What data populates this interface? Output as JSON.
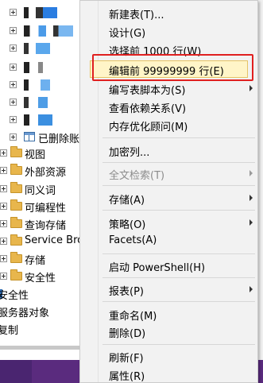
{
  "tree": {
    "deleted_label": "已删除账",
    "folders": [
      {
        "label": "视图"
      },
      {
        "label": "外部资源"
      },
      {
        "label": "同义词"
      },
      {
        "label": "可编程性"
      },
      {
        "label": "查询存储"
      },
      {
        "label": "Service Bro"
      },
      {
        "label": "存储"
      },
      {
        "label": "安全性"
      }
    ],
    "security_label": "安全性",
    "server_objects_label": "服务器对象",
    "replication_label": "复制"
  },
  "menu": {
    "new_table": "新建表(T)...",
    "design": "设计(G)",
    "select_top": "选择前 1000 行(W)",
    "edit_top": "编辑前 99999999 行(E)",
    "script_as": "编写表脚本为(S)",
    "view_deps": "查看依赖关系(V)",
    "memory_advisor": "内存优化顾问(M)",
    "encrypt_columns": "加密列...",
    "fulltext_index": "全文检索(T)",
    "storage": "存储(A)",
    "policies": "策略(O)",
    "facets": "Facets(A)",
    "powershell": "启动 PowerShell(H)",
    "reports": "报表(P)",
    "rename": "重命名(M)",
    "delete": "删除(D)",
    "refresh": "刷新(F)",
    "properties": "属性(R)"
  },
  "colors": {
    "highlight_fill": "#fff5c8",
    "highlight_border": "#e5c365",
    "annotation_red": "#e02020",
    "folder": "#e8b64c",
    "taskbar": "#5a2b7e"
  }
}
